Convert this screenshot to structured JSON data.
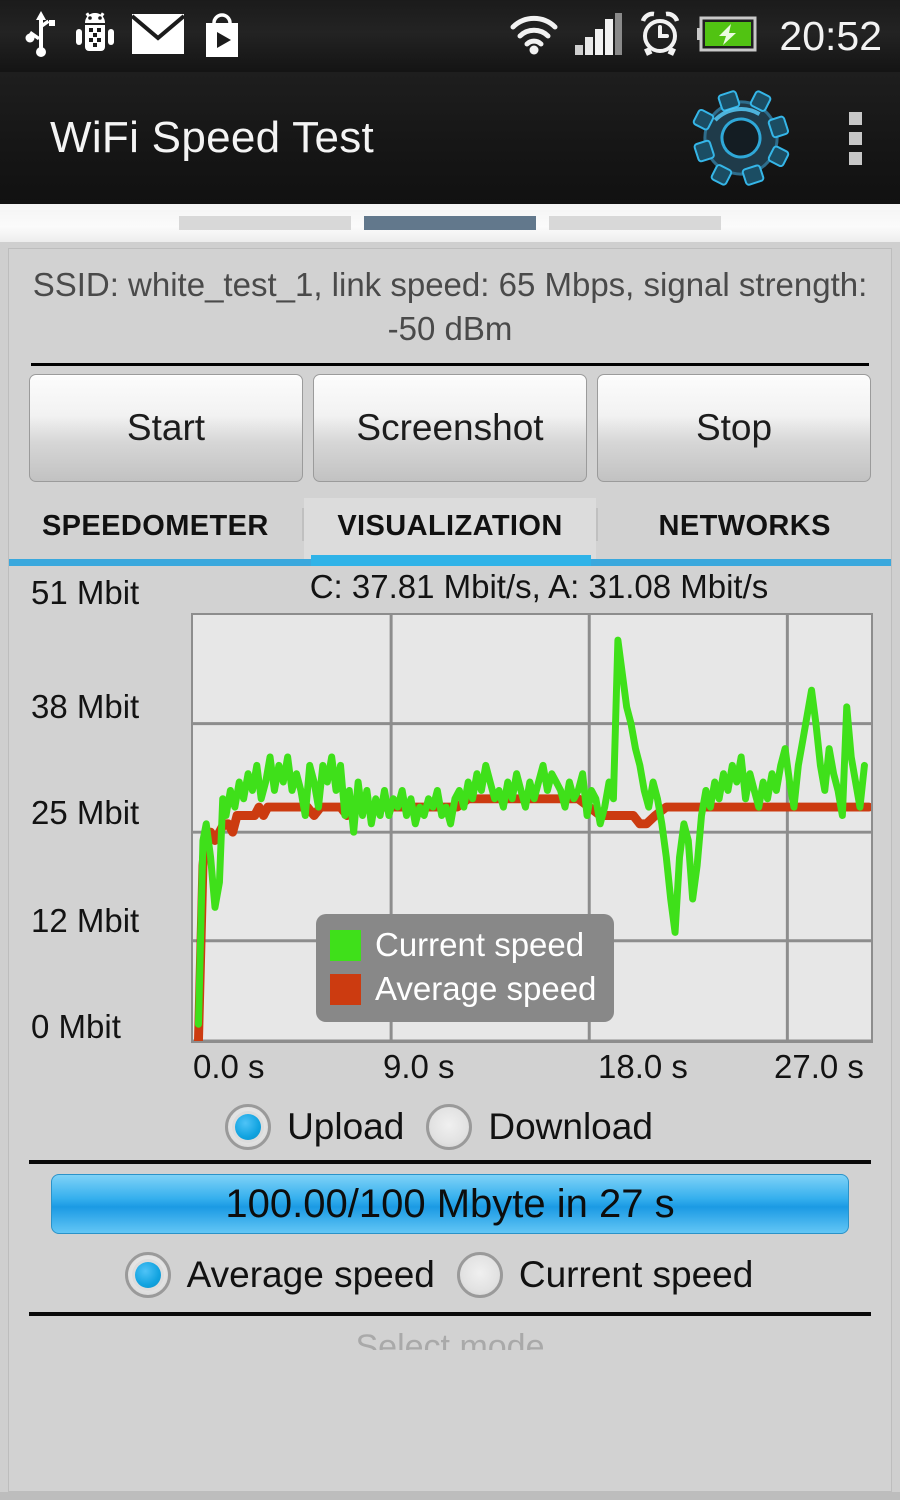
{
  "statusbar": {
    "time": "20:52",
    "left_icons": [
      "usb-icon",
      "android-debug-icon",
      "mail-icon",
      "play-store-icon"
    ],
    "right_icons": [
      "wifi-icon",
      "cellular-signal-icon",
      "alarm-icon",
      "battery-charging-icon"
    ]
  },
  "actionbar": {
    "title": "WiFi Speed Test",
    "logo_icon": "gear-logo-icon",
    "overflow_icon": "overflow-menu-icon"
  },
  "page_indicator": {
    "count": 3,
    "active_index": 1
  },
  "info": {
    "ssid_line": "SSID: white_test_1, link speed: 65 Mbps, signal strength: -50 dBm"
  },
  "buttons": [
    {
      "label": "Start",
      "name": "start-button"
    },
    {
      "label": "Screenshot",
      "name": "screenshot-button"
    },
    {
      "label": "Stop",
      "name": "stop-button"
    }
  ],
  "tabs": [
    {
      "label": "SPEEDOMETER",
      "selected": false
    },
    {
      "label": "VISUALIZATION",
      "selected": true
    },
    {
      "label": "NETWORKS",
      "selected": false
    }
  ],
  "colors": {
    "accent_blue": "#2fb3e8",
    "current_speed": "#3fe01a",
    "average_speed": "#cc3b10",
    "indicator_active": "#62788c",
    "legend_bg": "#888888",
    "card_bg": "#d2d2d2"
  },
  "direction_radio": {
    "options": [
      {
        "label": "Upload",
        "selected": true
      },
      {
        "label": "Download",
        "selected": false
      }
    ]
  },
  "progress": {
    "text": "100.00/100 Mbyte in 27 s",
    "percent": 100
  },
  "mode_radio": {
    "options": [
      {
        "label": "Average speed",
        "selected": true
      },
      {
        "label": "Current speed",
        "selected": false
      }
    ]
  },
  "footer": {
    "select_mode_label": "Select mode"
  },
  "chart_data": {
    "type": "line",
    "title": "C: 37.81 Mbit/s, A: 31.08 Mbit/s",
    "xlabel": "",
    "ylabel": "",
    "grid": true,
    "legend_position": "bottom-right",
    "xlim": [
      0,
      30.8
    ],
    "ylim": [
      0,
      51
    ],
    "ytick_labels": [
      "51 Mbit",
      "38 Mbit",
      "25 Mbit",
      "12 Mbit",
      "0 Mbit"
    ],
    "ytick_values": [
      51,
      38,
      25,
      12,
      0
    ],
    "xtick_labels": [
      "0.0 s",
      "9.0 s",
      "18.0 s",
      "27.0 s"
    ],
    "xtick_values": [
      0,
      9,
      18,
      27
    ],
    "current_label": "C: 37.81 Mbit/s",
    "average_label": "A: 31.08 Mbit/s",
    "series": [
      {
        "name": "Current speed",
        "color": "#3fe01a",
        "x": [
          0.25,
          0.45,
          0.6,
          0.8,
          1.0,
          1.2,
          1.35,
          1.5,
          1.7,
          1.9,
          2.1,
          2.3,
          2.5,
          2.7,
          2.9,
          3.1,
          3.3,
          3.5,
          3.7,
          3.9,
          4.1,
          4.3,
          4.5,
          4.7,
          4.9,
          5.1,
          5.3,
          5.5,
          5.7,
          5.9,
          6.1,
          6.3,
          6.5,
          6.7,
          6.9,
          7.1,
          7.3,
          7.5,
          7.7,
          7.9,
          8.1,
          8.3,
          8.5,
          8.7,
          8.9,
          9.1,
          9.3,
          9.5,
          9.7,
          9.9,
          10.1,
          10.3,
          10.5,
          10.7,
          10.9,
          11.1,
          11.3,
          11.5,
          11.7,
          11.9,
          12.1,
          12.3,
          12.5,
          12.7,
          12.9,
          13.1,
          13.3,
          13.5,
          13.7,
          13.9,
          14.1,
          14.3,
          14.5,
          14.7,
          14.9,
          15.1,
          15.3,
          15.5,
          15.7,
          15.9,
          16.1,
          16.3,
          16.5,
          16.7,
          16.9,
          17.1,
          17.3,
          17.5,
          17.7,
          17.9,
          18.1,
          18.3,
          18.5,
          18.7,
          18.9,
          19.1,
          19.3,
          19.5,
          19.7,
          19.9,
          20.1,
          20.3,
          20.5,
          20.7,
          20.9,
          21.1,
          21.3,
          21.5,
          21.7,
          21.9,
          22.1,
          22.3,
          22.5,
          22.7,
          22.9,
          23.1,
          23.3,
          23.5,
          23.7,
          23.9,
          24.1,
          24.3,
          24.5,
          24.7,
          24.9,
          25.1,
          25.3,
          25.5,
          25.7,
          25.9,
          26.1,
          26.3,
          26.5,
          26.7,
          26.9,
          27.1,
          27.3,
          27.5,
          27.7,
          27.9,
          28.1,
          28.3,
          28.5,
          28.7,
          28.9,
          29.1,
          29.3,
          29.5,
          29.7,
          29.9,
          30.1,
          30.3,
          30.5,
          30.7
        ],
        "y": [
          2,
          24,
          26,
          22,
          16,
          19,
          29,
          27,
          30,
          28,
          31,
          29,
          32,
          30,
          33,
          29,
          31,
          34,
          30,
          33,
          31,
          34,
          30,
          32,
          30,
          27,
          33,
          31,
          28,
          33,
          31,
          34,
          30,
          33,
          27,
          30,
          25,
          31,
          27,
          30,
          26,
          29,
          27,
          30,
          27,
          29,
          28,
          30,
          27,
          29,
          26,
          28,
          27,
          29,
          28,
          30,
          27,
          28,
          26,
          29,
          30,
          28,
          31,
          29,
          32,
          30,
          33,
          31,
          29,
          30,
          28,
          31,
          29,
          32,
          30,
          28,
          31,
          29,
          31,
          33,
          30,
          32,
          31,
          30,
          28,
          31,
          29,
          30,
          32,
          27,
          30,
          29,
          26,
          28,
          31,
          29,
          48,
          44,
          40,
          38,
          35,
          33,
          30,
          28,
          31,
          29,
          26,
          22,
          17,
          13,
          22,
          26,
          24,
          17,
          21,
          27,
          30,
          28,
          31,
          29,
          32,
          30,
          33,
          31,
          34,
          29,
          32,
          30,
          28,
          31,
          29,
          32,
          30,
          33,
          35,
          31,
          28,
          33,
          36,
          39,
          42,
          38,
          33,
          30,
          35,
          32,
          30,
          27,
          40,
          34,
          31,
          28,
          33
        ]
      },
      {
        "name": "Average speed",
        "color": "#cc3b10",
        "x": [
          0.25,
          0.45,
          0.6,
          0.8,
          1.0,
          1.2,
          1.4,
          1.6,
          1.8,
          2.0,
          2.2,
          2.4,
          2.6,
          2.8,
          3.0,
          3.2,
          3.4,
          3.6,
          3.8,
          4.0,
          4.3,
          4.6,
          4.9,
          5.2,
          5.5,
          5.8,
          6.1,
          6.4,
          6.7,
          7.0,
          7.3,
          7.6,
          7.9,
          8.2,
          8.5,
          8.8,
          9.1,
          9.4,
          9.7,
          10.0,
          10.5,
          11.0,
          11.5,
          12.0,
          12.5,
          13.0,
          13.5,
          14.0,
          14.5,
          15.0,
          15.5,
          16.0,
          16.5,
          17.0,
          17.5,
          18.0,
          18.5,
          19.0,
          19.5,
          20.0,
          20.3,
          20.6,
          21.0,
          21.5,
          22.0,
          22.5,
          23.0,
          24.0,
          25.0,
          26.0,
          27.0,
          28.0,
          29.0,
          30.0,
          30.7
        ],
        "y": [
          0,
          21,
          25,
          25,
          24,
          25,
          26,
          26,
          25,
          27,
          27,
          27,
          27,
          27,
          28,
          27,
          28,
          28,
          28,
          28,
          28,
          28,
          28,
          28,
          27,
          28,
          28,
          28,
          28,
          27,
          28,
          28,
          28,
          28,
          28,
          28,
          28,
          28,
          28,
          28,
          28,
          28,
          28,
          28,
          29,
          29,
          29,
          29,
          29,
          29,
          29,
          29,
          29,
          29,
          29,
          28,
          27,
          27,
          27,
          27,
          26,
          26,
          27,
          28,
          28,
          28,
          28,
          28,
          28,
          28,
          28,
          28,
          28,
          28,
          28
        ]
      }
    ]
  }
}
